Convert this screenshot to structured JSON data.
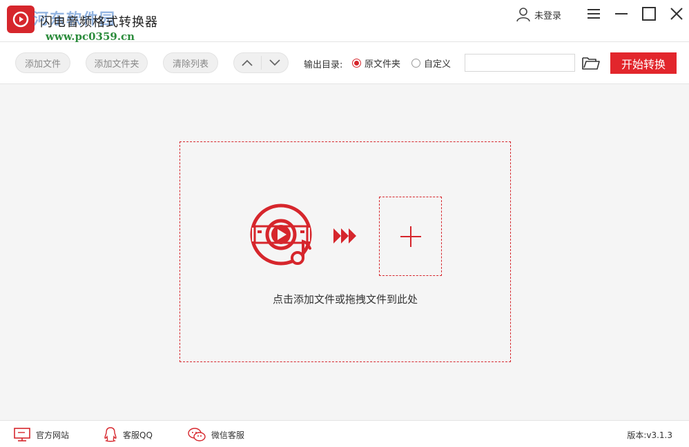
{
  "app": {
    "title": "闪电音频格式转换器",
    "watermark_name": "河东软件园",
    "watermark_url": "www.pc0359.cn",
    "accent_color": "#d6262c"
  },
  "header": {
    "login_label": "未登录",
    "window_controls": [
      "menu-icon",
      "minimize-icon",
      "maximize-icon",
      "close-icon"
    ]
  },
  "toolbar": {
    "add_file_label": "添加文件",
    "add_folder_label": "添加文件夹",
    "clear_list_label": "清除列表",
    "output_dir_label": "输出目录:",
    "radio_original_label": "原文件夹",
    "radio_custom_label": "自定义",
    "selected_output": "原文件夹",
    "path_value": "",
    "start_label": "开始转换"
  },
  "dropzone": {
    "hint": "点击添加文件或拖拽文件到此处"
  },
  "footer": {
    "website_label": "官方网站",
    "qq_label": "客服QQ",
    "wechat_label": "微信客服",
    "version_label": "版本:v3.1.3"
  }
}
